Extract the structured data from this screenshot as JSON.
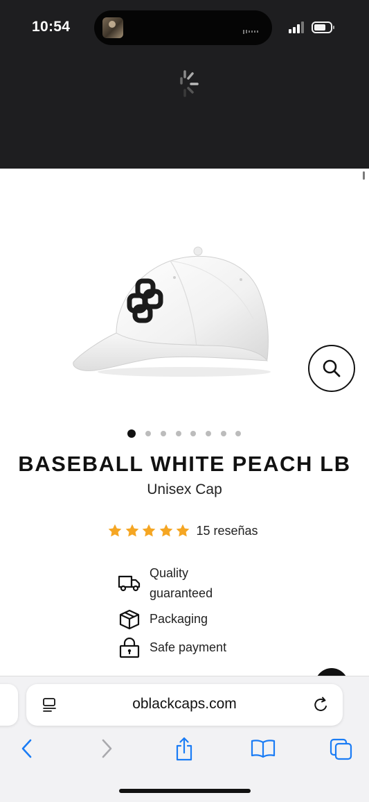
{
  "status_bar": {
    "time": "10:54"
  },
  "product": {
    "title": "BASEBALL WHITE PEACH LB",
    "subtitle": "Unisex Cap",
    "image_alt": "white baseball cap",
    "image_count": 8,
    "active_image": 1
  },
  "rating": {
    "stars": 5,
    "max_stars": 5,
    "reviews_label": "15 reseñas",
    "star_color": "#f5a623"
  },
  "features": [
    {
      "icon": "truck-icon",
      "label_line1": "Quality",
      "label_line2": "guaranteed"
    },
    {
      "icon": "box-icon",
      "label": "Packaging"
    },
    {
      "icon": "lock-icon",
      "label": "Safe payment"
    }
  ],
  "browser": {
    "url": "oblackcaps.com",
    "accent": "#1a7cf5"
  },
  "colors": {
    "header_dark": "#1e1e20",
    "text": "#111111"
  }
}
